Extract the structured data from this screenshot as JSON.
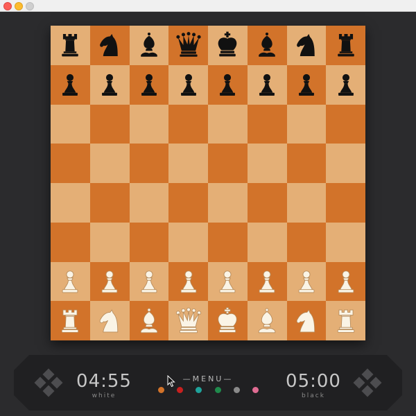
{
  "window": {
    "controls": [
      "close",
      "minimize",
      "zoom"
    ]
  },
  "board": {
    "rows": [
      [
        "black-rook",
        "black-knight",
        "black-bishop",
        "black-queen",
        "black-king",
        "black-bishop",
        "black-knight",
        "black-rook"
      ],
      [
        "black-pawn",
        "black-pawn",
        "black-pawn",
        "black-pawn",
        "black-pawn",
        "black-pawn",
        "black-pawn",
        "black-pawn"
      ],
      [
        "",
        "",
        "",
        "",
        "",
        "",
        "",
        ""
      ],
      [
        "",
        "",
        "",
        "",
        "",
        "",
        "",
        ""
      ],
      [
        "",
        "",
        "",
        "",
        "",
        "",
        "",
        ""
      ],
      [
        "",
        "",
        "",
        "",
        "",
        "",
        "",
        ""
      ],
      [
        "white-pawn",
        "white-pawn",
        "white-pawn",
        "white-pawn",
        "white-pawn",
        "white-pawn",
        "white-pawn",
        "white-pawn"
      ],
      [
        "white-rook",
        "white-knight",
        "white-bishop",
        "white-queen",
        "white-king",
        "white-bishop",
        "white-knight",
        "white-rook"
      ]
    ],
    "light_color": "#e4af76",
    "dark_color": "#d2732a"
  },
  "panel": {
    "white_time": "04:55",
    "white_label": "white",
    "black_time": "05:00",
    "black_label": "black",
    "menu_label": "—MENU—",
    "theme_colors": [
      "#d2732a",
      "#c8201f",
      "#1fa39b",
      "#1f8a4c",
      "#8a8a8a",
      "#e06c93"
    ]
  }
}
